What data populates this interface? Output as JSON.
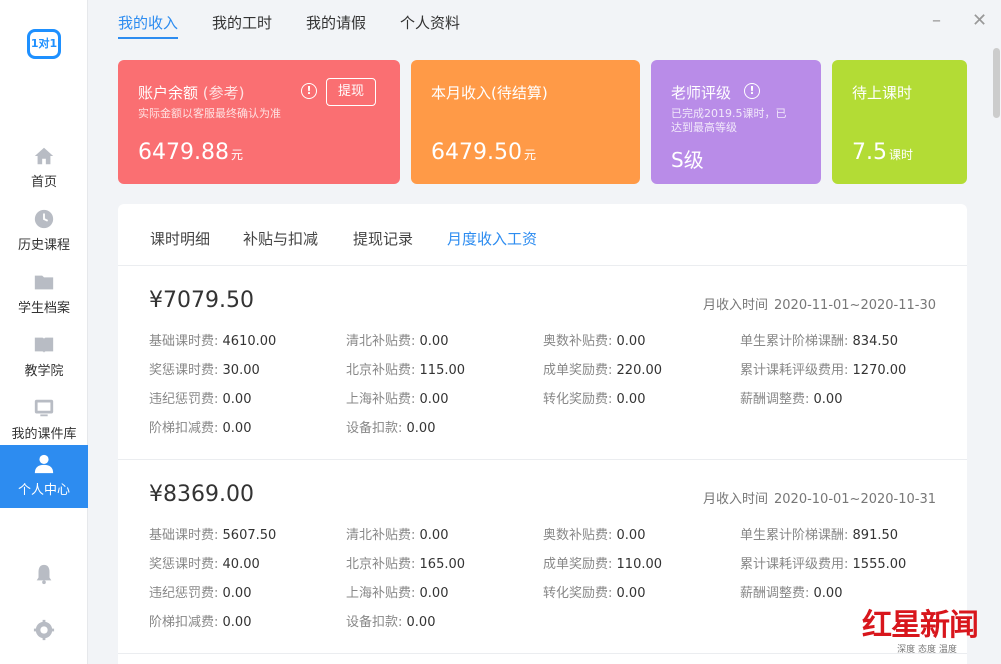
{
  "logo": {
    "text": "1对1"
  },
  "sidebar": {
    "items": [
      {
        "label": "首页",
        "icon": "home-icon"
      },
      {
        "label": "历史课程",
        "icon": "clock-icon"
      },
      {
        "label": "学生档案",
        "icon": "folder-icon"
      },
      {
        "label": "教学院",
        "icon": "book-icon"
      },
      {
        "label": "我的课件库",
        "icon": "monitor-icon"
      },
      {
        "label": "个人中心",
        "icon": "user-icon",
        "active": true
      }
    ],
    "bottom_icons": [
      "bell-icon",
      "gear-icon"
    ]
  },
  "top_tabs": [
    "我的收入",
    "我的工时",
    "我的请假",
    "个人资料"
  ],
  "window": {
    "minimize": "–",
    "close": "✕"
  },
  "cards": {
    "balance": {
      "title": "账户余额",
      "title_suffix": "(参考)",
      "note": "实际金额以客服最终确认为准",
      "amount": "6479.88",
      "unit": "元",
      "button": "提现",
      "info": "!"
    },
    "month": {
      "title": "本月收入(待结算)",
      "amount": "6479.50",
      "unit": "元"
    },
    "rating": {
      "title": "老师评级",
      "note_line1": "已完成2019.5课时，已",
      "note_line2": "达到最高等级",
      "level": "S级",
      "info": "!"
    },
    "pending": {
      "title": "待上课时",
      "amount": "7.5",
      "unit": "课时"
    }
  },
  "colors": {
    "balance": "#fa6f72",
    "month": "#ff9a47",
    "rating": "#b98ce8",
    "pending": "#b3dc35",
    "accent": "#2d8cf0"
  },
  "sub_tabs": [
    "课时明细",
    "补贴与扣减",
    "提现记录",
    "月度收入工资"
  ],
  "records": [
    {
      "total": "¥7079.50",
      "period_label": "月收入时间",
      "period": "2020-11-01~2020-11-30",
      "items": [
        {
          "k": "基础课时费:",
          "v": "4610.00"
        },
        {
          "k": "清北补贴费:",
          "v": "0.00"
        },
        {
          "k": "奥数补贴费:",
          "v": "0.00"
        },
        {
          "k": "单生累计阶梯课酬:",
          "v": "834.50"
        },
        {
          "k": "奖惩课时费:",
          "v": "30.00"
        },
        {
          "k": "北京补贴费:",
          "v": "115.00"
        },
        {
          "k": "成单奖励费:",
          "v": "220.00"
        },
        {
          "k": "累计课耗评级费用:",
          "v": "1270.00"
        },
        {
          "k": "违纪惩罚费:",
          "v": "0.00"
        },
        {
          "k": "上海补贴费:",
          "v": "0.00"
        },
        {
          "k": "转化奖励费:",
          "v": "0.00"
        },
        {
          "k": "薪酬调整费:",
          "v": "0.00"
        },
        {
          "k": "阶梯扣减费:",
          "v": "0.00"
        },
        {
          "k": "设备扣款:",
          "v": "0.00"
        }
      ]
    },
    {
      "total": "¥8369.00",
      "period_label": "月收入时间",
      "period": "2020-10-01~2020-10-31",
      "items": [
        {
          "k": "基础课时费:",
          "v": "5607.50"
        },
        {
          "k": "清北补贴费:",
          "v": "0.00"
        },
        {
          "k": "奥数补贴费:",
          "v": "0.00"
        },
        {
          "k": "单生累计阶梯课酬:",
          "v": "891.50"
        },
        {
          "k": "奖惩课时费:",
          "v": "40.00"
        },
        {
          "k": "北京补贴费:",
          "v": "165.00"
        },
        {
          "k": "成单奖励费:",
          "v": "110.00"
        },
        {
          "k": "累计课耗评级费用:",
          "v": "1555.00"
        },
        {
          "k": "违纪惩罚费:",
          "v": "0.00"
        },
        {
          "k": "上海补贴费:",
          "v": "0.00"
        },
        {
          "k": "转化奖励费:",
          "v": "0.00"
        },
        {
          "k": "薪酬调整费:",
          "v": "0.00"
        },
        {
          "k": "阶梯扣减费:",
          "v": "0.00"
        },
        {
          "k": "设备扣款:",
          "v": "0.00"
        }
      ]
    }
  ],
  "watermark": {
    "brand": "红星新闻",
    "slogan": "深度 态度 温度"
  }
}
